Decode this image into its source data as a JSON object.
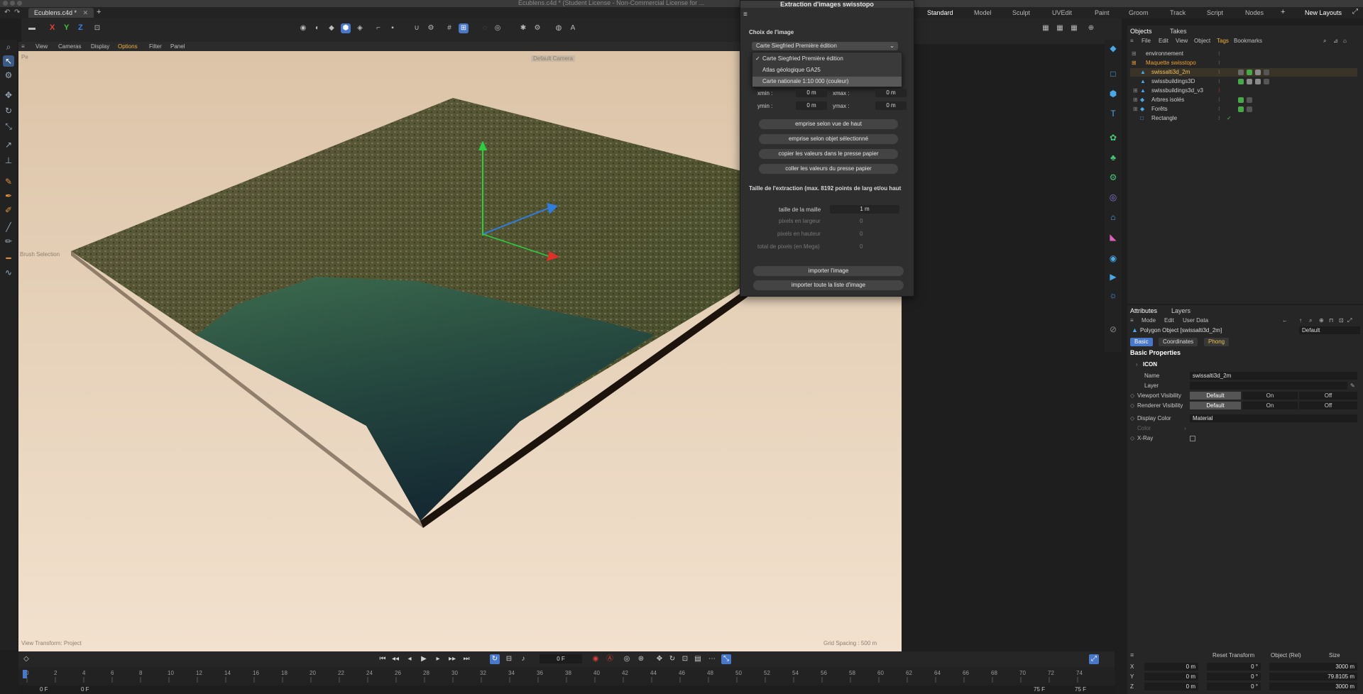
{
  "window": {
    "title": "Ecublens.c4d * (Student License - Non-Commercial License for ..."
  },
  "tabs": {
    "document": "Ecublens.c4d *",
    "layouts": [
      "Standard",
      "Model",
      "Sculpt",
      "UVEdit",
      "Paint",
      "Groom",
      "Track",
      "Script",
      "Nodes"
    ],
    "active_layout": "Standard",
    "new_layouts": "New Layouts"
  },
  "viewport_menu": [
    "View",
    "Cameras",
    "Display",
    "Options",
    "Filter",
    "Panel"
  ],
  "viewport": {
    "camera_label": "Default Camera",
    "perspective_label": "Pe",
    "brush_label": "Brush Selection",
    "view_transform": "View Transform: Project",
    "grid_spacing": "Grid Spacing : 500 m"
  },
  "dialog": {
    "title": "Extraction d'images swisstopo",
    "section_choice": "Choix de l'image",
    "dropdown_value": "Carte Siegfried Première édition",
    "options": [
      "Carte Siegfried Première édition",
      "Atlas géologique GA25",
      "Carte nationale 1:10 000 (couleur)"
    ],
    "checked_option": "✓",
    "xmin_label": "xmin :",
    "xmin": "0 m",
    "xmax_label": "xmax :",
    "xmax": "0 m",
    "ymin_label": "ymin :",
    "ymin": "0 m",
    "ymax_label": "ymax :",
    "ymax": "0 m",
    "btn_top_view": "emprise selon vue de haut",
    "btn_selected": "emprise selon objet sélectionné",
    "btn_copy": "copier les valeurs dans le presse papier",
    "btn_paste": "coller les valeurs du presse papier",
    "section_size": "Taille de l'extraction (max. 8192 points de larg et/ou haut",
    "mesh_label": "taille de la maille",
    "mesh_value": "1 m",
    "px_width_label": "pixels en largeur",
    "px_width": "0",
    "px_height_label": "pixels en hauteur",
    "px_height": "0",
    "px_total_label": "total de pixels (en Mega)",
    "px_total": "0",
    "btn_import": "importer l'image",
    "btn_import_all": "importer toute la liste d'image"
  },
  "objects_panel": {
    "tabs": [
      "Objects",
      "Takes"
    ],
    "menu": [
      "File",
      "Edit",
      "View",
      "Object",
      "Tags",
      "Bookmarks"
    ],
    "items": [
      {
        "name": "environnement",
        "indent": 0
      },
      {
        "name": "Maquette swisstopo",
        "indent": 0
      },
      {
        "name": "swissalti3d_2m",
        "indent": 1
      },
      {
        "name": "swissbuildings3D",
        "indent": 1
      },
      {
        "name": "swissbuildings3d_v3",
        "indent": 1
      },
      {
        "name": "Arbres isolés",
        "indent": 1
      },
      {
        "name": "Forêts",
        "indent": 1
      },
      {
        "name": "Rectangle",
        "indent": 0
      }
    ]
  },
  "attributes": {
    "tabs": [
      "Attributes",
      "Layers"
    ],
    "menu": [
      "Mode",
      "Edit",
      "User Data"
    ],
    "object_title": "Polygon Object [swissalti3d_2m]",
    "preset": "Default",
    "subtabs": [
      "Basic",
      "Coordinates",
      "Phong"
    ],
    "section": "Basic Properties",
    "icon_group": "ICON",
    "name_label": "Name",
    "name_value": "swissalti3d_2m",
    "layer_label": "Layer",
    "viewport_vis_label": "Viewport Visibility",
    "renderer_vis_label": "Renderer Visibility",
    "vis_options": [
      "Default",
      "On",
      "Off"
    ],
    "display_color_label": "Display Color",
    "display_color_value": "Material",
    "color_label": "Color",
    "xray_label": "X-Ray"
  },
  "coordinates": {
    "reset": "Reset Transform",
    "mode": "Object (Rel)",
    "size_mode": "Size",
    "rows": [
      {
        "axis": "X",
        "pos": "0 m",
        "rot": "0 °",
        "size": "3000 m"
      },
      {
        "axis": "Y",
        "pos": "0 m",
        "rot": "0 °",
        "size": "79.8105 m"
      },
      {
        "axis": "Z",
        "pos": "0 m",
        "rot": "0 °",
        "size": "3000 m"
      }
    ]
  },
  "timeline": {
    "current_frame": "0 F",
    "ticks": [
      "0",
      "2",
      "4",
      "6",
      "8",
      "10",
      "12",
      "14",
      "16",
      "18",
      "20",
      "22",
      "24",
      "26",
      "28",
      "30",
      "32",
      "34",
      "36",
      "38",
      "40",
      "42",
      "44",
      "46",
      "48",
      "50",
      "52",
      "54",
      "56",
      "58",
      "60",
      "62",
      "64",
      "66",
      "68",
      "70",
      "72",
      "74"
    ],
    "start_frame": "0 F",
    "min_frame": "0 F",
    "max_frame": "75 F",
    "end_frame": "75 F"
  },
  "colors": {
    "accent": "#4a78c8",
    "selected_object": "#f0a030",
    "green_axis": "#2ecc40",
    "red_axis": "#e0302a",
    "blue_axis": "#2f7de1"
  }
}
